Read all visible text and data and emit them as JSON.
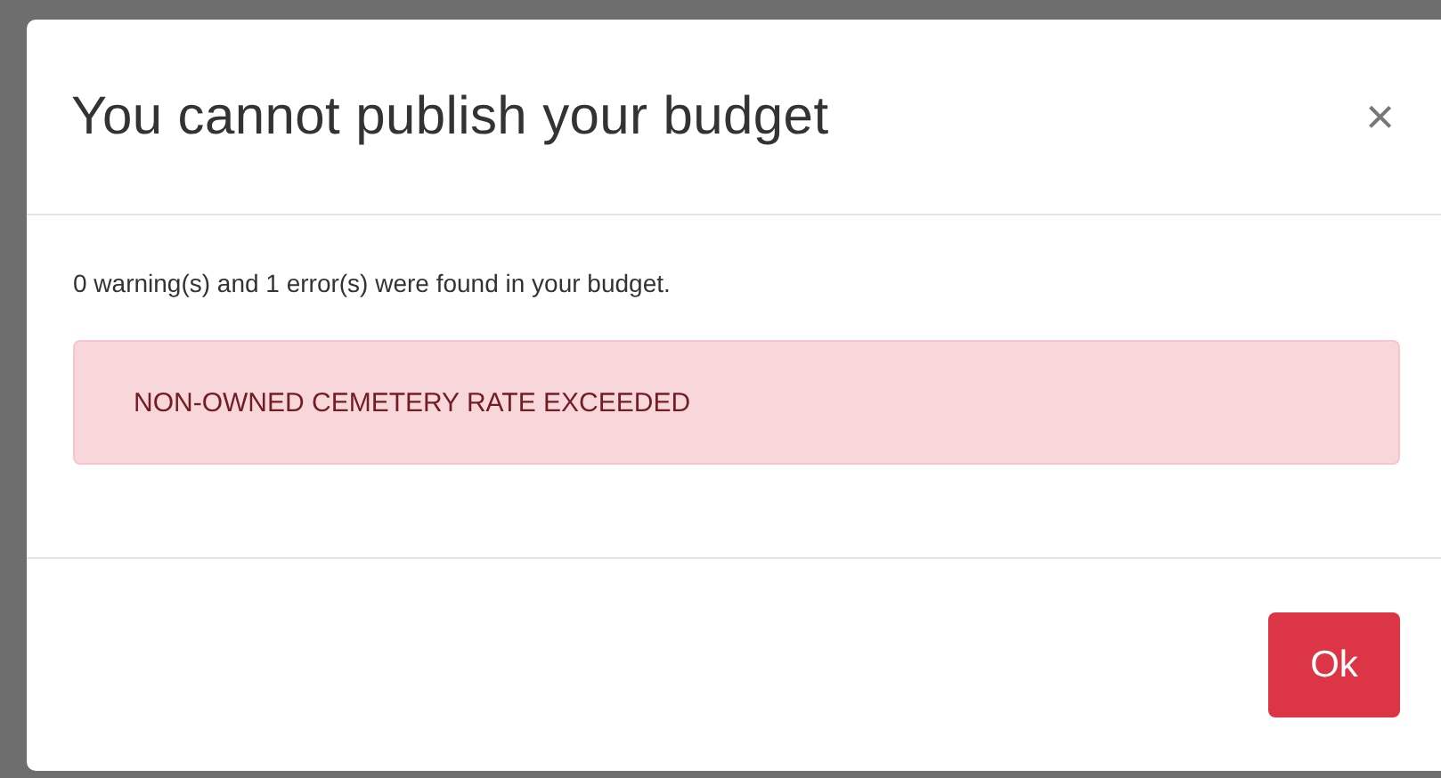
{
  "dialog": {
    "title": "You cannot publish your budget",
    "close": "×",
    "summary": "0 warning(s) and 1 error(s) were found in your budget.",
    "alerts": [
      {
        "kind": "error",
        "text": "NON-OWNED CEMETERY RATE EXCEEDED"
      }
    ],
    "buttons": [
      {
        "label": "Ok",
        "kind": "danger"
      }
    ]
  }
}
